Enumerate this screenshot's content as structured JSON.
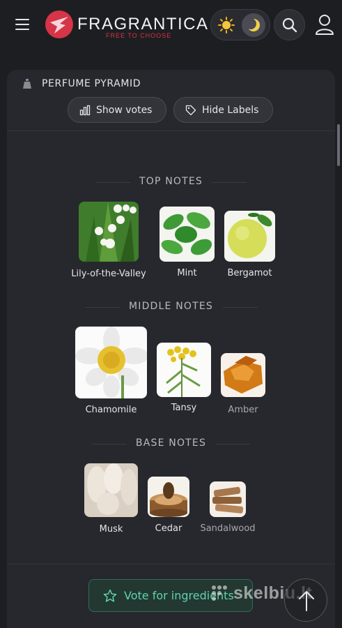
{
  "header": {
    "logo_name": "FRAGRANTICA",
    "logo_tagline": "FREE TO CHOOSE",
    "icons": [
      "menu-icon",
      "sun-icon",
      "moon-icon",
      "search-icon",
      "user-icon"
    ]
  },
  "card": {
    "title": "PERFUME PYRAMID",
    "show_votes": "Show votes",
    "hide_labels": "Hide Labels"
  },
  "sections": {
    "top": {
      "title": "TOP NOTES",
      "notes": [
        {
          "name": "Lily-of-the-Valley"
        },
        {
          "name": "Mint"
        },
        {
          "name": "Bergamot"
        }
      ]
    },
    "middle": {
      "title": "MIDDLE NOTES",
      "notes": [
        {
          "name": "Chamomile"
        },
        {
          "name": "Tansy"
        },
        {
          "name": "Amber"
        }
      ]
    },
    "base": {
      "title": "BASE NOTES",
      "notes": [
        {
          "name": "Musk"
        },
        {
          "name": "Cedar"
        },
        {
          "name": "Sandalwood"
        }
      ]
    }
  },
  "footer": {
    "vote_button": "Vote for ingredients",
    "watermark": "skelbiu.lt"
  },
  "colors": {
    "background": "#1d1e22",
    "card": "#27282d",
    "accent_red": "#d63447",
    "accent_green": "#5fd2b1"
  }
}
